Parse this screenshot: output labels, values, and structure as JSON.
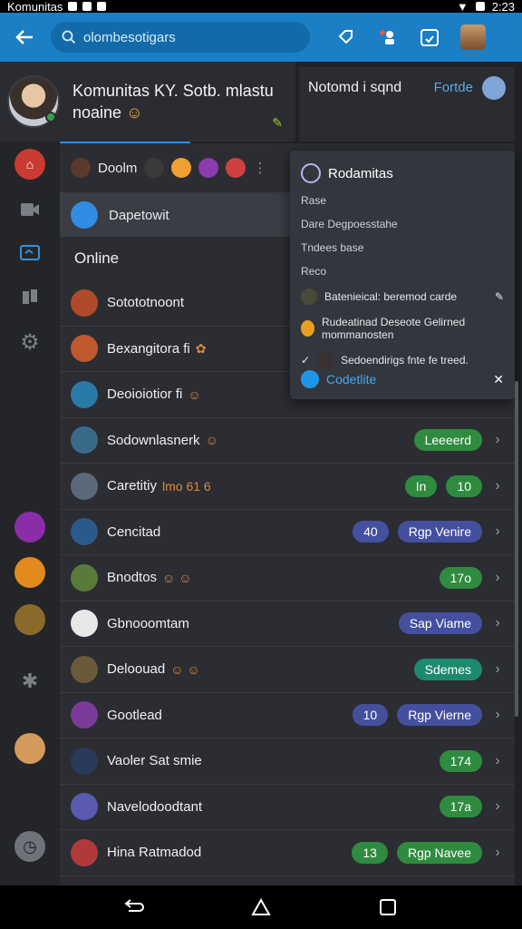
{
  "statusbar": {
    "app_name": "Komunitas",
    "time": "2:23"
  },
  "appbar": {
    "search_placeholder": "olombesotigars"
  },
  "profile": {
    "line1": "Komunitas KY. Sotb. mlastu",
    "line2": "noaine"
  },
  "right_header": {
    "title": "Notomd i sqnd",
    "link": "Fortde"
  },
  "top_row": {
    "label": "Doolm"
  },
  "selected_row": {
    "label": "Dapetowit"
  },
  "section": {
    "title": "Online"
  },
  "contacts": [
    {
      "name": "Sotototnoont",
      "emoji": "",
      "pills": []
    },
    {
      "name": "Bexangitora fi",
      "emoji": "✿",
      "pills": []
    },
    {
      "name": "Deoioiotior fi",
      "emoji": "☺",
      "pills": []
    },
    {
      "name": "Sodownlasnerk",
      "emoji": "☺",
      "pills": [
        {
          "text": "Leeeerd",
          "color": "green"
        }
      ]
    },
    {
      "name": "Caretitiy",
      "emoji": "lmo 61 6",
      "pills": [
        {
          "text": "In",
          "color": "green"
        },
        {
          "text": "10",
          "color": "green"
        }
      ]
    },
    {
      "name": "Cencitad",
      "emoji": "",
      "pills": [
        {
          "text": "40",
          "color": "blue"
        },
        {
          "text": "Rgp Venire",
          "color": "blue"
        }
      ]
    },
    {
      "name": "Bnodtos",
      "emoji": "☺ ☺",
      "pills": [
        {
          "text": "17o",
          "color": "green"
        }
      ]
    },
    {
      "name": "Gbnooomtam",
      "emoji": "",
      "pills": [
        {
          "text": "Sap Viame",
          "color": "blue"
        }
      ]
    },
    {
      "name": "Deloouad",
      "emoji": "☺ ☺",
      "pills": [
        {
          "text": "Sdemes",
          "color": "teal"
        }
      ]
    },
    {
      "name": "Gootlead",
      "emoji": "",
      "pills": [
        {
          "text": "10",
          "color": "blue"
        },
        {
          "text": "Rgp Vierne",
          "color": "blue"
        }
      ]
    },
    {
      "name": "Vaoler Sat smie",
      "emoji": "",
      "pills": [
        {
          "text": "174",
          "color": "green"
        }
      ]
    },
    {
      "name": "Navelodoodtant",
      "emoji": "",
      "pills": [
        {
          "text": "17a",
          "color": "green"
        }
      ]
    },
    {
      "name": "Hina Ratmadod",
      "emoji": "",
      "pills": [
        {
          "text": "13",
          "color": "green"
        },
        {
          "text": "Rgp Navee",
          "color": "green"
        }
      ]
    }
  ],
  "popup": {
    "title": "Rodamitas",
    "label1": "Rase",
    "line1": "Dare Degpoesstahe",
    "line2": "Tndees base",
    "label2": "Reco",
    "items": [
      "Batenieical: beremod carde",
      "Rudeatinad Deseote Gelirned mommanosten",
      "Sedoendirigs fnte fe treed."
    ],
    "footer": "Codetlite"
  },
  "colors": {
    "appbar": "#1a7fc4",
    "accent": "#2f8de4",
    "green": "#2f8b3f",
    "blue": "#44509e",
    "teal": "#1d8a6e"
  }
}
